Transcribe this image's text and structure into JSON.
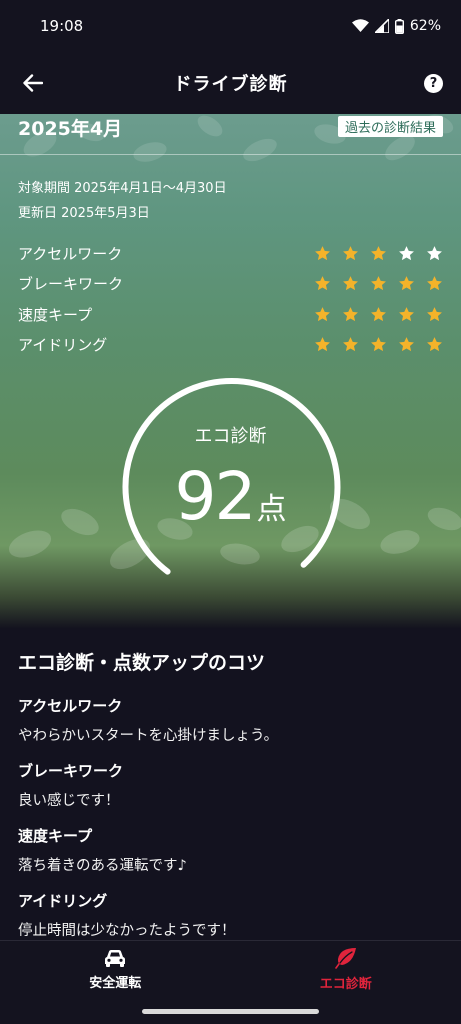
{
  "status_bar": {
    "time": "19:08",
    "battery": "62%"
  },
  "app_bar": {
    "title": "ドライブ診断",
    "help_symbol": "?"
  },
  "hero": {
    "month": "2025年4月",
    "history_button": "過去の診断結果",
    "period": "対象期間 2025年4月1日〜4月30日",
    "updated": "更新日 2025年5月3日",
    "ratings": [
      {
        "label": "アクセルワーク",
        "stars": 3,
        "max": 5
      },
      {
        "label": "ブレーキワーク",
        "stars": 5,
        "max": 5
      },
      {
        "label": "速度キープ",
        "stars": 5,
        "max": 5
      },
      {
        "label": "アイドリング",
        "stars": 5,
        "max": 5
      }
    ],
    "gauge": {
      "title": "エコ診断",
      "score": "92",
      "unit": "点"
    }
  },
  "tips": {
    "title": "エコ診断・点数アップのコツ",
    "items": [
      {
        "heading": "アクセルワーク",
        "body": "やわらかいスタートを心掛けましょう。"
      },
      {
        "heading": "ブレーキワーク",
        "body": "良い感じです！"
      },
      {
        "heading": "速度キープ",
        "body": "落ち着きのある運転です♪"
      },
      {
        "heading": "アイドリング",
        "body": "停止時間は少なかったようです！"
      }
    ]
  },
  "bottom_nav": {
    "items": [
      {
        "label": "安全運転",
        "icon": "car-icon",
        "active": false
      },
      {
        "label": "エコ診断",
        "icon": "leaf-icon",
        "active": true
      }
    ]
  },
  "colors": {
    "accent": "#e0243c",
    "star_filled": "#f4b32a",
    "star_empty": "#ffffff",
    "background": "#13121f"
  }
}
